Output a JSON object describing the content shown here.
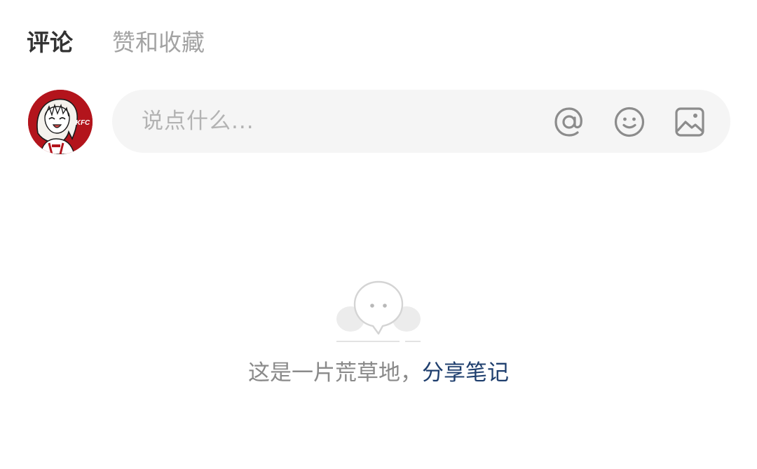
{
  "tabs": {
    "comments": "评论",
    "likes_favorites": "赞和收藏"
  },
  "comment_box": {
    "placeholder": "说点什么...",
    "icons": [
      "at-icon",
      "emoji-icon",
      "image-icon"
    ]
  },
  "avatar": {
    "badge_text": "KFC"
  },
  "empty_state": {
    "message": "这是一片荒草地，",
    "action": "分享笔记"
  },
  "colors": {
    "active_tab": "#333333",
    "inactive_tab": "#a3a3a3",
    "input_bg": "#f5f5f5",
    "placeholder": "#b3b3b3",
    "empty_text": "#8a8a8a",
    "link": "#1f3f6e",
    "avatar_bg": "#b3141c"
  }
}
